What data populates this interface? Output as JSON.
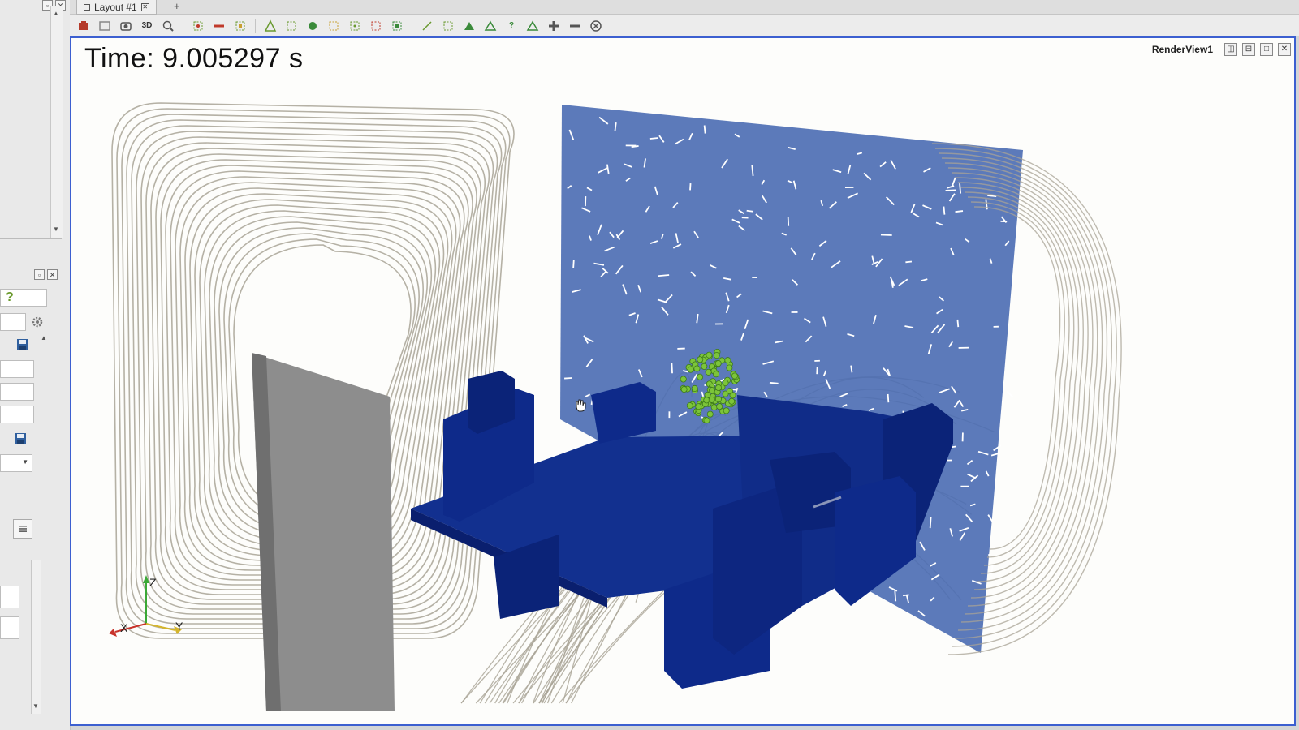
{
  "tabs": [
    {
      "label": "Layout #1"
    }
  ],
  "tab_add_label": "+",
  "toolbar": {
    "icons": [
      "reset-camera-icon",
      "zoom-data-icon",
      "capture-icon",
      "toggle-3d-icon",
      "zoom-box-icon",
      "select-cells-icon",
      "select-points-icon",
      "select-block-icon",
      "select-cells-polygon-icon",
      "select-points-polygon-icon",
      "interactive-select-icon",
      "extract-selection-icon",
      "grow-selection-icon",
      "shrink-selection-icon",
      "clear-selection-icon",
      "probe-icon",
      "hover-points-icon",
      "query-icon",
      "plus-icon",
      "minus-icon",
      "close-circle-icon"
    ],
    "toggle_3d_label": "3D"
  },
  "render_view": {
    "name": "RenderView1",
    "time_label": "Time: 9.005297 s",
    "axes": {
      "x": "X",
      "y": "Y",
      "z": "Z"
    },
    "colors": {
      "background": "#fdfdfb",
      "border": "#3c5fd0",
      "slice_plane": "#4a6bb3",
      "geometry": "#0e2a8a",
      "wall": "#8d8d8d",
      "streamlines": "#a8a395",
      "particles": "#7cc43a"
    }
  },
  "left_dock": {
    "help_label": "?",
    "icons": [
      "dock-float-icon",
      "dock-close-icon",
      "gear-icon",
      "save-icon",
      "save-icon-2",
      "dropdown-arrow-icon",
      "list-icon"
    ]
  }
}
